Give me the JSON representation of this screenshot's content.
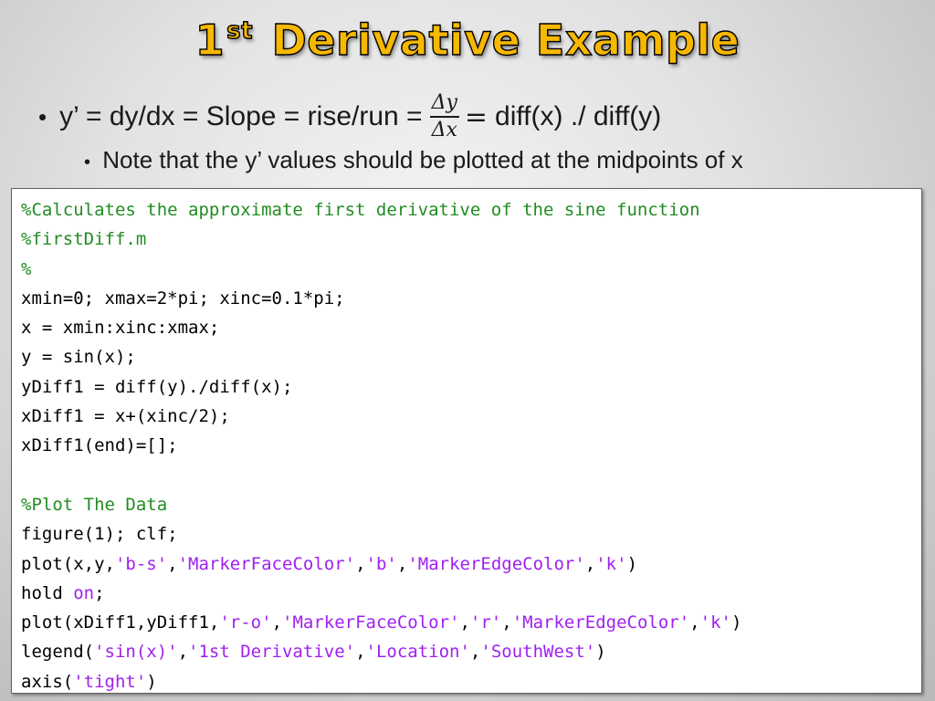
{
  "slide": {
    "title_main": "1",
    "title_sup": "st",
    "title_rest": " Derivative Example",
    "bullet1": {
      "text_before": "y’ = dy/dx = Slope = rise/run = ",
      "fraction_numerator": "Δy",
      "fraction_denominator": "Δx",
      "equals": "=",
      "text_after": " diff(x) ./ diff(y)"
    },
    "bullet2": "Note that the y’ values should be plotted at the midpoints of x",
    "bullet_symbol": "•"
  },
  "code": {
    "line1": "%Calculates the approximate first derivative of the sine function",
    "line2": "%firstDiff.m",
    "line3": "%",
    "line4": "xmin=0; xmax=2*pi; xinc=0.1*pi;",
    "line5": "x = xmin:xinc:xmax;",
    "line6": "y = sin(x);",
    "line7": "yDiff1 = diff(y)./diff(x);",
    "line8": "xDiff1 = x+(xinc/2);",
    "line9": "xDiff1(end)=[];",
    "line10": "",
    "line11": "%Plot The Data",
    "line12": "figure(1); clf;",
    "line13": {
      "p1": "plot(x,y,",
      "s1": "'b-s'",
      "c1": ",",
      "s2": "'MarkerFaceColor'",
      "c2": ",",
      "s3": "'b'",
      "c3": ",",
      "s4": "'MarkerEdgeColor'",
      "c4": ",",
      "s5": "'k'",
      "end": ")"
    },
    "line14": {
      "p1": "hold ",
      "s1": "on",
      "end": ";"
    },
    "line15": {
      "p1": "plot(xDiff1,yDiff1,",
      "s1": "'r-o'",
      "c1": ",",
      "s2": "'MarkerFaceColor'",
      "c2": ",",
      "s3": "'r'",
      "c3": ",",
      "s4": "'MarkerEdgeColor'",
      "c4": ",",
      "s5": "'k'",
      "end": ")"
    },
    "line16": {
      "p1": "legend(",
      "s1": "'sin(x)'",
      "c1": ",",
      "s2": "'1st Derivative'",
      "c2": ",",
      "s3": "'Location'",
      "c3": ",",
      "s4": "'SouthWest'",
      "end": ")"
    },
    "line17": {
      "p1": "axis(",
      "s1": "'tight'",
      "end": ")"
    }
  },
  "colors": {
    "title": "#f6b800",
    "comment": "#228b22",
    "string": "#a020f0",
    "code_text": "#000000"
  }
}
